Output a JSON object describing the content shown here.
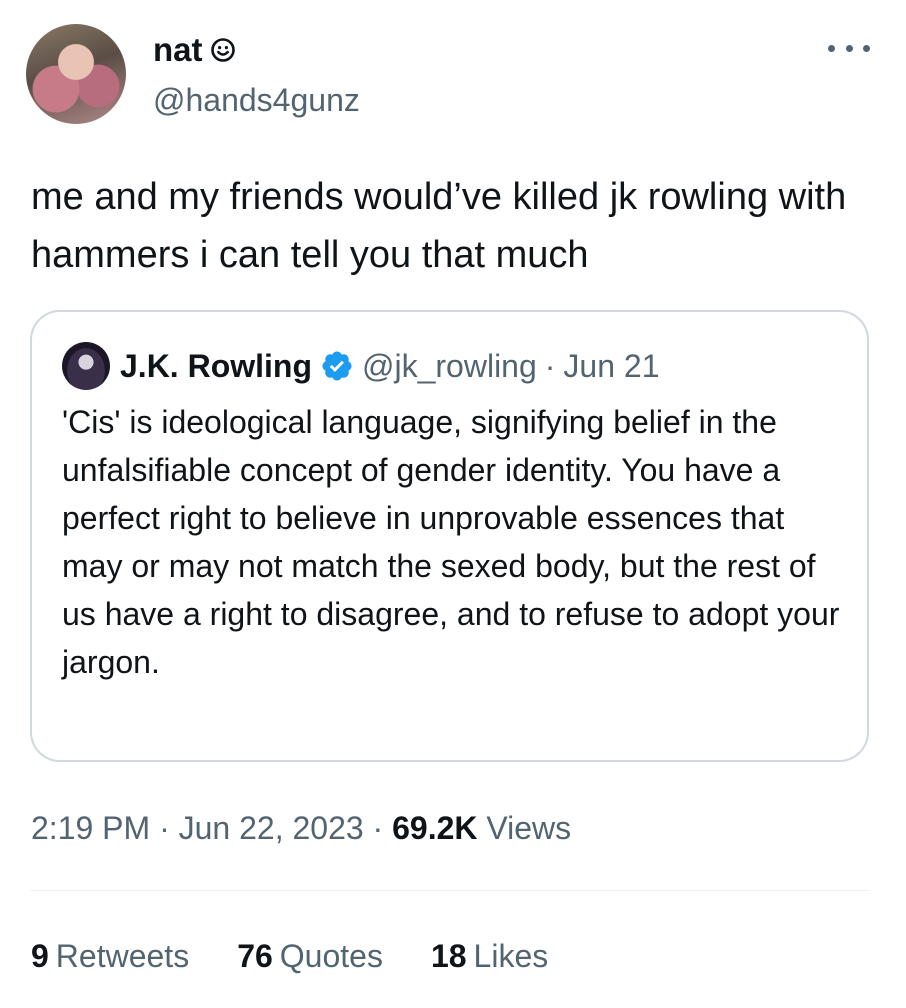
{
  "author": {
    "display_name": "nat",
    "handle": "@hands4gunz",
    "name_icon": "smiley-face-icon",
    "avatar_icon": "user-avatar"
  },
  "menu": {
    "icon": "more-options-icon"
  },
  "tweet": {
    "text": "me and my friends would’ve killed jk rowling with hammers i can tell you that much"
  },
  "quoted_tweet": {
    "display_name": "J.K. Rowling",
    "verified_icon": "verified-badge-icon",
    "handle": "@jk_rowling",
    "separator": "·",
    "date": "Jun 21",
    "text": "'Cis' is ideological language, signifying belief in the unfalsifiable concept of gender identity. You have a perfect right to believe in unprovable essences that may or may not match the sexed body, but the rest of us have a right to disagree, and to refuse to adopt your jargon."
  },
  "meta": {
    "time": "2:19 PM",
    "separator": "·",
    "date": "Jun 22, 2023",
    "views_count": "69.2K",
    "views_label": "Views"
  },
  "stats": {
    "retweets_count": "9",
    "retweets_label": "Retweets",
    "quotes_count": "76",
    "quotes_label": "Quotes",
    "likes_count": "18",
    "likes_label": "Likes"
  },
  "colors": {
    "text_primary": "#0f1419",
    "text_secondary": "#536471",
    "border": "#cfd9de",
    "verified_blue": "#1d9bf0"
  }
}
